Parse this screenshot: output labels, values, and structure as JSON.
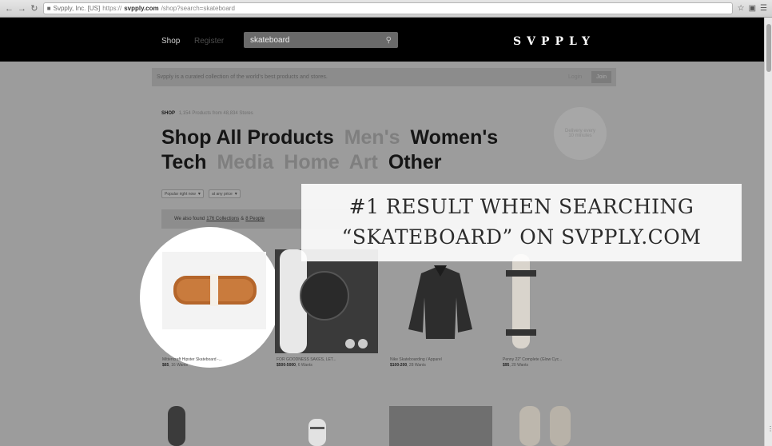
{
  "browser": {
    "url_ev_label": "Svpply, Inc. [US]",
    "url_scheme": "https://",
    "url_domain": "svpply.com",
    "url_path": "/shop?search=skateboard"
  },
  "nav": {
    "shop": "Shop",
    "register": "Register",
    "search_value": "skateboard",
    "logo": "SVPPLY"
  },
  "intro": {
    "text": "Svpply is a curated collection of the world's best products and stores.",
    "login": "Login",
    "join": "Join"
  },
  "shop": {
    "tag": "SHOP",
    "meta": "1,154 Products from 48,834 Stores",
    "categories": [
      {
        "label": "Shop All Products",
        "active": true
      },
      {
        "label": "Men's",
        "active": false
      },
      {
        "label": "Women's",
        "active": true
      },
      {
        "label": "Tech",
        "active": true
      },
      {
        "label": "Media",
        "active": false
      },
      {
        "label": "Home",
        "active": false
      },
      {
        "label": "Art",
        "active": false
      },
      {
        "label": "Other",
        "active": true
      }
    ],
    "badge": "Delivery every 10 minutes"
  },
  "filters": {
    "sort": "Popular right now",
    "price": "at any price"
  },
  "found": {
    "prefix": "We also found",
    "collections": "176 Collections",
    "separator": "&",
    "people": "8 People"
  },
  "overlay": {
    "line1": "#1 RESULT WHEN SEARCHING",
    "line2": "“SKATEBOARD” ON SVPPLY.COM"
  },
  "products": [
    {
      "name": "Mittencraft Hipster Skateboard -...",
      "price": "$65",
      "wants": "16 Wants"
    },
    {
      "name": "FOR GOODNESS SAKES, LET...",
      "price": "$500-5000",
      "wants": "6 Wants"
    },
    {
      "name": "Nike Skateboarding / Apparel",
      "price": "$100-200",
      "wants": "28 Wants"
    },
    {
      "name": "Penny 22\" Complete (Glow Cyc...",
      "price": "$95",
      "wants": "20 Wants"
    }
  ],
  "colors": {
    "nav_bg": "#000000",
    "page_dim": "#9c9c9c",
    "highlight": "#ffffff"
  }
}
